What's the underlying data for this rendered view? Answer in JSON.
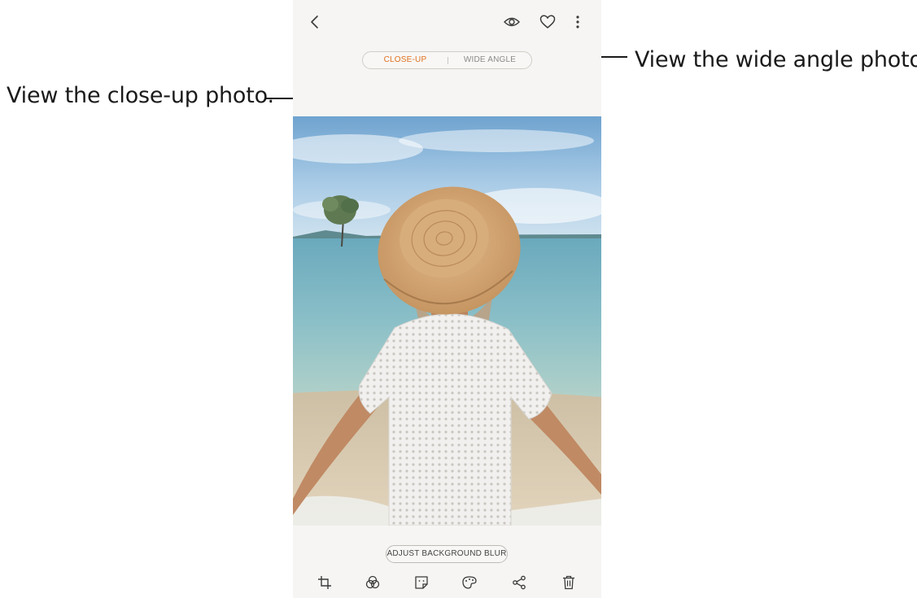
{
  "callouts": {
    "closeup": "View the close-up photo.",
    "wide": "View the wide angle photo."
  },
  "toolbar": {
    "icons": [
      "back-icon",
      "view-icon",
      "heart-icon",
      "more-options-icon"
    ]
  },
  "view_switch": {
    "closeup_label": "CLOSE-UP",
    "wide_label": "WIDE ANGLE",
    "selected": "CLOSE-UP",
    "selected_color": "#e0701d",
    "unselected_color": "#8a8a8a"
  },
  "actions": {
    "adjust_blur_label": "ADJUST BACKGROUND BLUR"
  },
  "bottom_tools": [
    "crop-icon",
    "filter-icon",
    "sticker-icon",
    "draw-icon",
    "share-icon",
    "delete-icon"
  ],
  "colors": {
    "screen_background": "#f6f5f3",
    "accent": "#e0701d",
    "icon": "#3a3a3a"
  }
}
